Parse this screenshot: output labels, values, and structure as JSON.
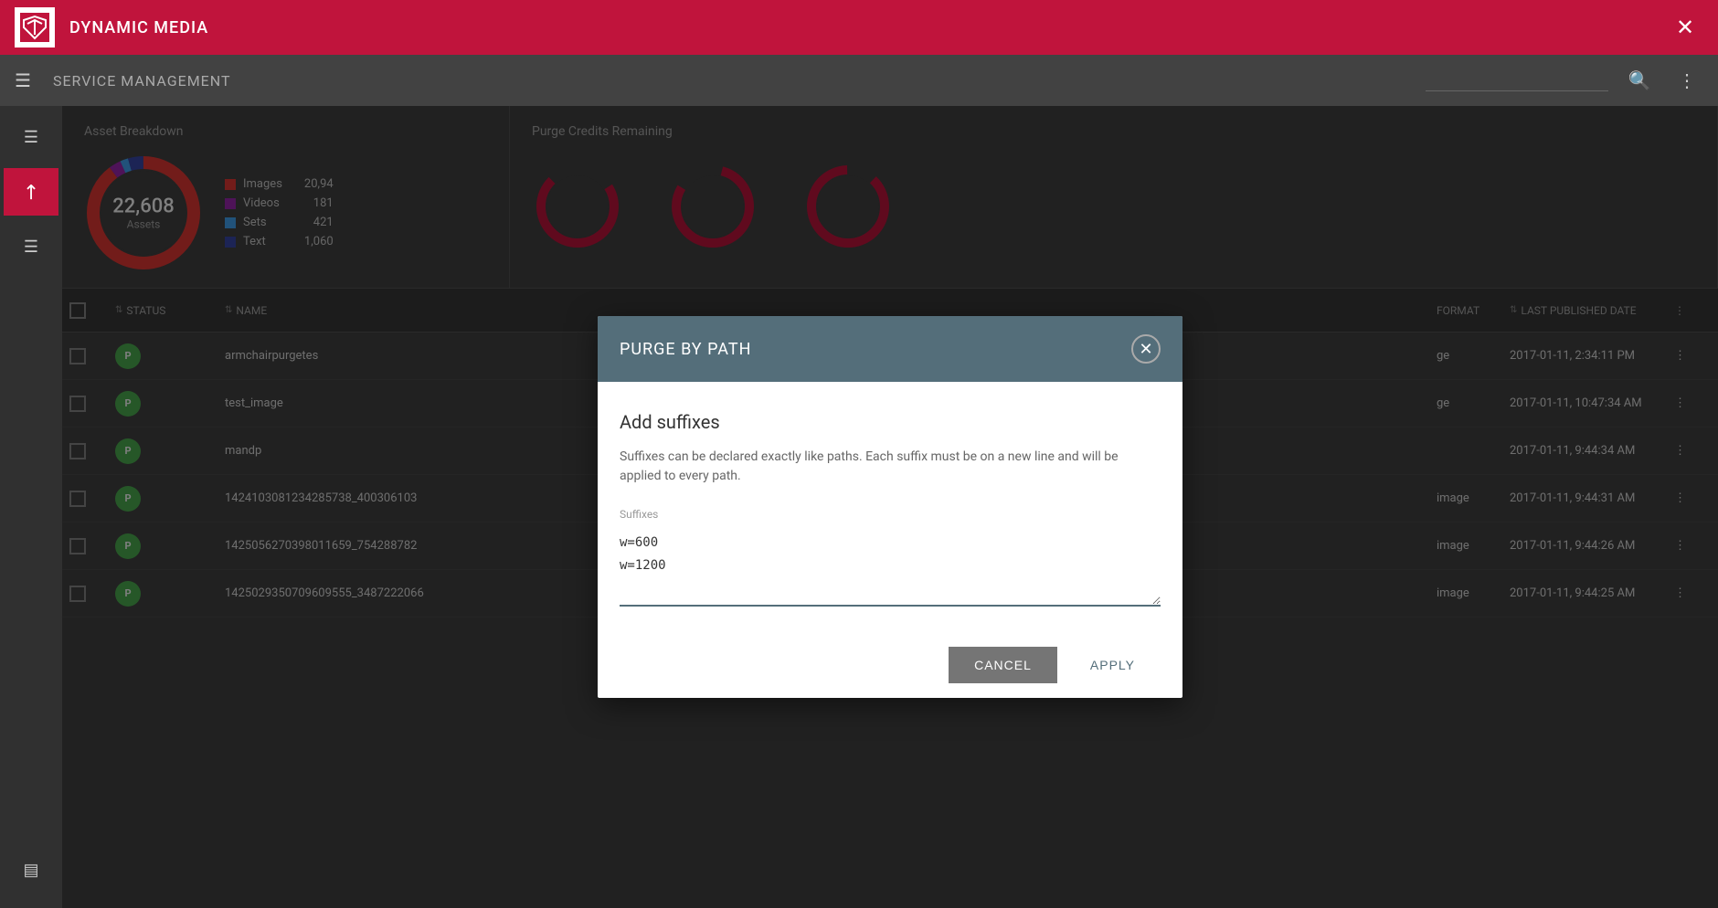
{
  "header": {
    "title": "DYNAMIC MEDIA",
    "close_label": "✕"
  },
  "sub_header": {
    "title": "SERVICE MANAGEMENT",
    "search_placeholder": ""
  },
  "sidebar": {
    "items": [
      {
        "icon": "☰",
        "label": "menu",
        "active": false
      },
      {
        "icon": "↗",
        "label": "dashboard",
        "active": true
      },
      {
        "icon": "☰",
        "label": "list",
        "active": false
      },
      {
        "icon": "▤",
        "label": "grid",
        "active": false
      }
    ]
  },
  "asset_breakdown": {
    "title": "Asset Breakdown",
    "total": "22,608",
    "label": "Assets",
    "legend": [
      {
        "color": "#e53935",
        "name": "Images",
        "value": "20,94"
      },
      {
        "color": "#9c27b0",
        "name": "Videos",
        "value": "181"
      },
      {
        "color": "#42a5f5",
        "name": "Sets",
        "value": "421"
      },
      {
        "color": "#3949ab",
        "name": "Text",
        "value": "1,060"
      }
    ]
  },
  "purge_credits": {
    "title": "Purge Credits Remaining"
  },
  "table": {
    "columns": [
      "",
      "Status",
      "Name",
      "Format",
      "Last Published Date",
      ""
    ],
    "rows": [
      {
        "status": "P",
        "name": "armchairpurgetes",
        "format": "ge",
        "date": "2017-01-11, 2:34:11 PM"
      },
      {
        "status": "P",
        "name": "test_image",
        "format": "ge",
        "date": "2017-01-11, 10:47:34 AM"
      },
      {
        "status": "P",
        "name": "mandp",
        "format": "",
        "date": "2017-01-11, 9:44:34 AM"
      },
      {
        "status": "P",
        "name": "1424103081234285738_400306103",
        "format": "image",
        "date": "2017-01-11, 9:44:31 AM"
      },
      {
        "status": "P",
        "name": "1425056270398011659_754288782",
        "format": "image",
        "date": "2017-01-11, 9:44:26 AM"
      },
      {
        "status": "P",
        "name": "1425029350709609555_3487222066",
        "format": "image",
        "date": "2017-01-11, 9:44:25 AM"
      }
    ]
  },
  "modal": {
    "title": "PURGE BY PATH",
    "section_title": "Add suffixes",
    "description": "Suffixes can be declared exactly like paths. Each suffix must be on a new line and will be applied to every path.",
    "field_label": "Suffixes",
    "field_value": "w=600\nw=1200",
    "cancel_label": "CANCEL",
    "apply_label": "APPLY"
  }
}
